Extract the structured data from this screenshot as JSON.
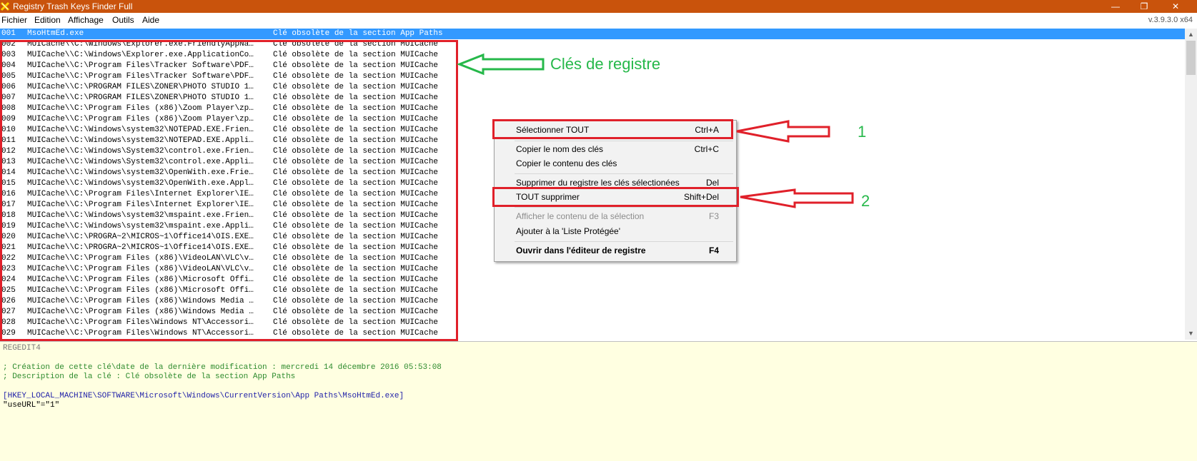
{
  "window": {
    "title": "Registry Trash Keys Finder Full",
    "controls": {
      "minimize": "—",
      "maximize": "❐",
      "close": "✕"
    },
    "version": "v.3.9.3.0 x64",
    "titlebar_color": "#c9530c"
  },
  "menubar": {
    "items": [
      "Fichier",
      "Edition",
      "Affichage",
      "Outils",
      "Aide"
    ]
  },
  "list": {
    "selection_color": "#3399ff",
    "rows": [
      {
        "num": "001",
        "key": "MsoHtmEd.exe",
        "desc": "Clé obsolète de la section App Paths"
      },
      {
        "num": "002",
        "key": "MUICache\\\\C:\\Windows\\Explorer.exe.FriendlyAppNa…",
        "desc": "Clé obsolète de la section MUICache"
      },
      {
        "num": "003",
        "key": "MUICache\\\\C:\\Windows\\Explorer.exe.ApplicationCo…",
        "desc": "Clé obsolète de la section MUICache"
      },
      {
        "num": "004",
        "key": "MUICache\\\\C:\\Program Files\\Tracker Software\\PDF…",
        "desc": "Clé obsolète de la section MUICache"
      },
      {
        "num": "005",
        "key": "MUICache\\\\C:\\Program Files\\Tracker Software\\PDF…",
        "desc": "Clé obsolète de la section MUICache"
      },
      {
        "num": "006",
        "key": "MUICache\\\\C:\\PROGRAM FILES\\ZONER\\PHOTO STUDIO 1…",
        "desc": "Clé obsolète de la section MUICache"
      },
      {
        "num": "007",
        "key": "MUICache\\\\C:\\PROGRAM FILES\\ZONER\\PHOTO STUDIO 1…",
        "desc": "Clé obsolète de la section MUICache"
      },
      {
        "num": "008",
        "key": "MUICache\\\\C:\\Program Files (x86)\\Zoom Player\\zp…",
        "desc": "Clé obsolète de la section MUICache"
      },
      {
        "num": "009",
        "key": "MUICache\\\\C:\\Program Files (x86)\\Zoom Player\\zp…",
        "desc": "Clé obsolète de la section MUICache"
      },
      {
        "num": "010",
        "key": "MUICache\\\\C:\\Windows\\system32\\NOTEPAD.EXE.Frien…",
        "desc": "Clé obsolète de la section MUICache"
      },
      {
        "num": "011",
        "key": "MUICache\\\\C:\\Windows\\system32\\NOTEPAD.EXE.Appli…",
        "desc": "Clé obsolète de la section MUICache"
      },
      {
        "num": "012",
        "key": "MUICache\\\\C:\\Windows\\System32\\control.exe.Frien…",
        "desc": "Clé obsolète de la section MUICache"
      },
      {
        "num": "013",
        "key": "MUICache\\\\C:\\Windows\\System32\\control.exe.Appli…",
        "desc": "Clé obsolète de la section MUICache"
      },
      {
        "num": "014",
        "key": "MUICache\\\\C:\\Windows\\system32\\OpenWith.exe.Frie…",
        "desc": "Clé obsolète de la section MUICache"
      },
      {
        "num": "015",
        "key": "MUICache\\\\C:\\Windows\\system32\\OpenWith.exe.Appl…",
        "desc": "Clé obsolète de la section MUICache"
      },
      {
        "num": "016",
        "key": "MUICache\\\\C:\\Program Files\\Internet Explorer\\IE…",
        "desc": "Clé obsolète de la section MUICache"
      },
      {
        "num": "017",
        "key": "MUICache\\\\C:\\Program Files\\Internet Explorer\\IE…",
        "desc": "Clé obsolète de la section MUICache"
      },
      {
        "num": "018",
        "key": "MUICache\\\\C:\\Windows\\system32\\mspaint.exe.Frien…",
        "desc": "Clé obsolète de la section MUICache"
      },
      {
        "num": "019",
        "key": "MUICache\\\\C:\\Windows\\system32\\mspaint.exe.Appli…",
        "desc": "Clé obsolète de la section MUICache"
      },
      {
        "num": "020",
        "key": "MUICache\\\\C:\\PROGRA~2\\MICROS~1\\Office14\\OIS.EXE…",
        "desc": "Clé obsolète de la section MUICache"
      },
      {
        "num": "021",
        "key": "MUICache\\\\C:\\PROGRA~2\\MICROS~1\\Office14\\OIS.EXE…",
        "desc": "Clé obsolète de la section MUICache"
      },
      {
        "num": "022",
        "key": "MUICache\\\\C:\\Program Files (x86)\\VideoLAN\\VLC\\v…",
        "desc": "Clé obsolète de la section MUICache"
      },
      {
        "num": "023",
        "key": "MUICache\\\\C:\\Program Files (x86)\\VideoLAN\\VLC\\v…",
        "desc": "Clé obsolète de la section MUICache"
      },
      {
        "num": "024",
        "key": "MUICache\\\\C:\\Program Files (x86)\\Microsoft Offi…",
        "desc": "Clé obsolète de la section MUICache"
      },
      {
        "num": "025",
        "key": "MUICache\\\\C:\\Program Files (x86)\\Microsoft Offi…",
        "desc": "Clé obsolète de la section MUICache"
      },
      {
        "num": "026",
        "key": "MUICache\\\\C:\\Program Files (x86)\\Windows Media …",
        "desc": "Clé obsolète de la section MUICache"
      },
      {
        "num": "027",
        "key": "MUICache\\\\C:\\Program Files (x86)\\Windows Media …",
        "desc": "Clé obsolète de la section MUICache"
      },
      {
        "num": "028",
        "key": "MUICache\\\\C:\\Program Files\\Windows NT\\Accessori…",
        "desc": "Clé obsolète de la section MUICache"
      },
      {
        "num": "029",
        "key": "MUICache\\\\C:\\Program Files\\Windows NT\\Accessori…",
        "desc": "Clé obsolète de la section MUICache"
      }
    ]
  },
  "scrollbar": {
    "up_arrow": "▲",
    "down_arrow": "▼"
  },
  "details": {
    "header": "REGEDIT4",
    "comment_1": "; Création de cette clé\\date de la dernière modification : mercredi 14 décembre 2016 05:53:08",
    "comment_2": "; Description de la clé : Clé obsolète de la section App Paths",
    "key_path": "[HKEY_LOCAL_MACHINE\\SOFTWARE\\Microsoft\\Windows\\CurrentVersion\\App Paths\\MsoHtmEd.exe]",
    "value_line": "\"useURL\"=\"1\"",
    "background": "#ffffe1",
    "comment_color": "#2e8b2e",
    "key_color": "#1f1fa8"
  },
  "context_menu": {
    "items": [
      {
        "label": "Sélectionner TOUT",
        "shortcut": "Ctrl+A"
      },
      {
        "label": "Copier le nom des clés",
        "shortcut": "Ctrl+C"
      },
      {
        "label": "Copier le contenu des clés",
        "shortcut": ""
      },
      {
        "label": "Supprimer du registre les clés sélectionées",
        "shortcut": "Del"
      },
      {
        "label": "TOUT supprimer",
        "shortcut": "Shift+Del"
      },
      {
        "label": "Afficher le contenu de la sélection",
        "shortcut": "F3"
      },
      {
        "label": "Ajouter à la 'Liste Protégée'",
        "shortcut": ""
      },
      {
        "label": "Ouvrir dans l'éditeur de registre",
        "shortcut": "F4"
      }
    ]
  },
  "annotations": {
    "keys_label": "Clés de registre",
    "label_1": "1",
    "label_2": "2",
    "highlight_color": "#e0202a",
    "annotation_color": "#26b84a"
  }
}
